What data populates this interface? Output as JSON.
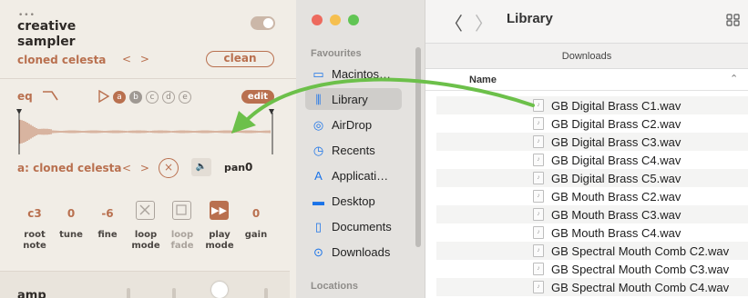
{
  "sampler": {
    "dots": "•••",
    "title": "creative sampler",
    "preset": "cloned celesta",
    "preset_arrows": "< >",
    "clean_label": "clean",
    "eq_label": "eq",
    "eq_bands": [
      "a",
      "b",
      "c",
      "d",
      "e"
    ],
    "edit_label": "edit",
    "sample_name": "a: cloned celesta",
    "sample_arrows": "< >",
    "x_glyph": "×",
    "mute_glyph": "🔈",
    "pan_label": "pan",
    "pan_value": "0",
    "params": [
      {
        "value": "c3",
        "label": "root note",
        "dim": false
      },
      {
        "value": "0",
        "label": "tune",
        "dim": false
      },
      {
        "value": "-6",
        "label": "fine",
        "dim": false
      },
      {
        "value": "",
        "label": "loop mode",
        "dim": false
      },
      {
        "value": "",
        "label": "loop fade",
        "dim": true
      },
      {
        "value": "",
        "label": "play mode",
        "dim": false
      },
      {
        "value": "0",
        "label": "gain",
        "dim": false
      }
    ],
    "amp_label": "amp",
    "accent_color": "#b9704f"
  },
  "finder": {
    "sidebar": {
      "favourites_label": "Favourites",
      "locations_label": "Locations",
      "items": [
        {
          "label": "Macintos…",
          "icon": "harddrive-icon",
          "glyph": "▭"
        },
        {
          "label": "Library",
          "icon": "library-icon",
          "glyph": "⫼"
        },
        {
          "label": "AirDrop",
          "icon": "airdrop-icon",
          "glyph": "◎"
        },
        {
          "label": "Recents",
          "icon": "clock-icon",
          "glyph": "◷"
        },
        {
          "label": "Applicati…",
          "icon": "applications-icon",
          "glyph": "A"
        },
        {
          "label": "Desktop",
          "icon": "desktop-icon",
          "glyph": "▬"
        },
        {
          "label": "Documents",
          "icon": "document-icon",
          "glyph": "▯"
        },
        {
          "label": "Downloads",
          "icon": "downloads-icon",
          "glyph": "⊙"
        }
      ],
      "selected_index": 1
    },
    "toolbar": {
      "back_glyph": "〈",
      "forward_glyph": "〉",
      "title": "Library"
    },
    "path_label": "Downloads",
    "column_name": "Name",
    "sort_glyph": "⌃",
    "files": [
      "GB Digital Brass C1.wav",
      "GB Digital Brass C2.wav",
      "GB Digital Brass C3.wav",
      "GB Digital Brass C4.wav",
      "GB Digital Brass C5.wav",
      "GB Mouth Brass C2.wav",
      "GB Mouth Brass C3.wav",
      "GB Mouth Brass C4.wav",
      "GB Spectral Mouth Comb C2.wav",
      "GB Spectral Mouth Comb C3.wav",
      "GB Spectral Mouth Comb C4.wav"
    ]
  },
  "drag_arrow_color": "#6cc04a"
}
